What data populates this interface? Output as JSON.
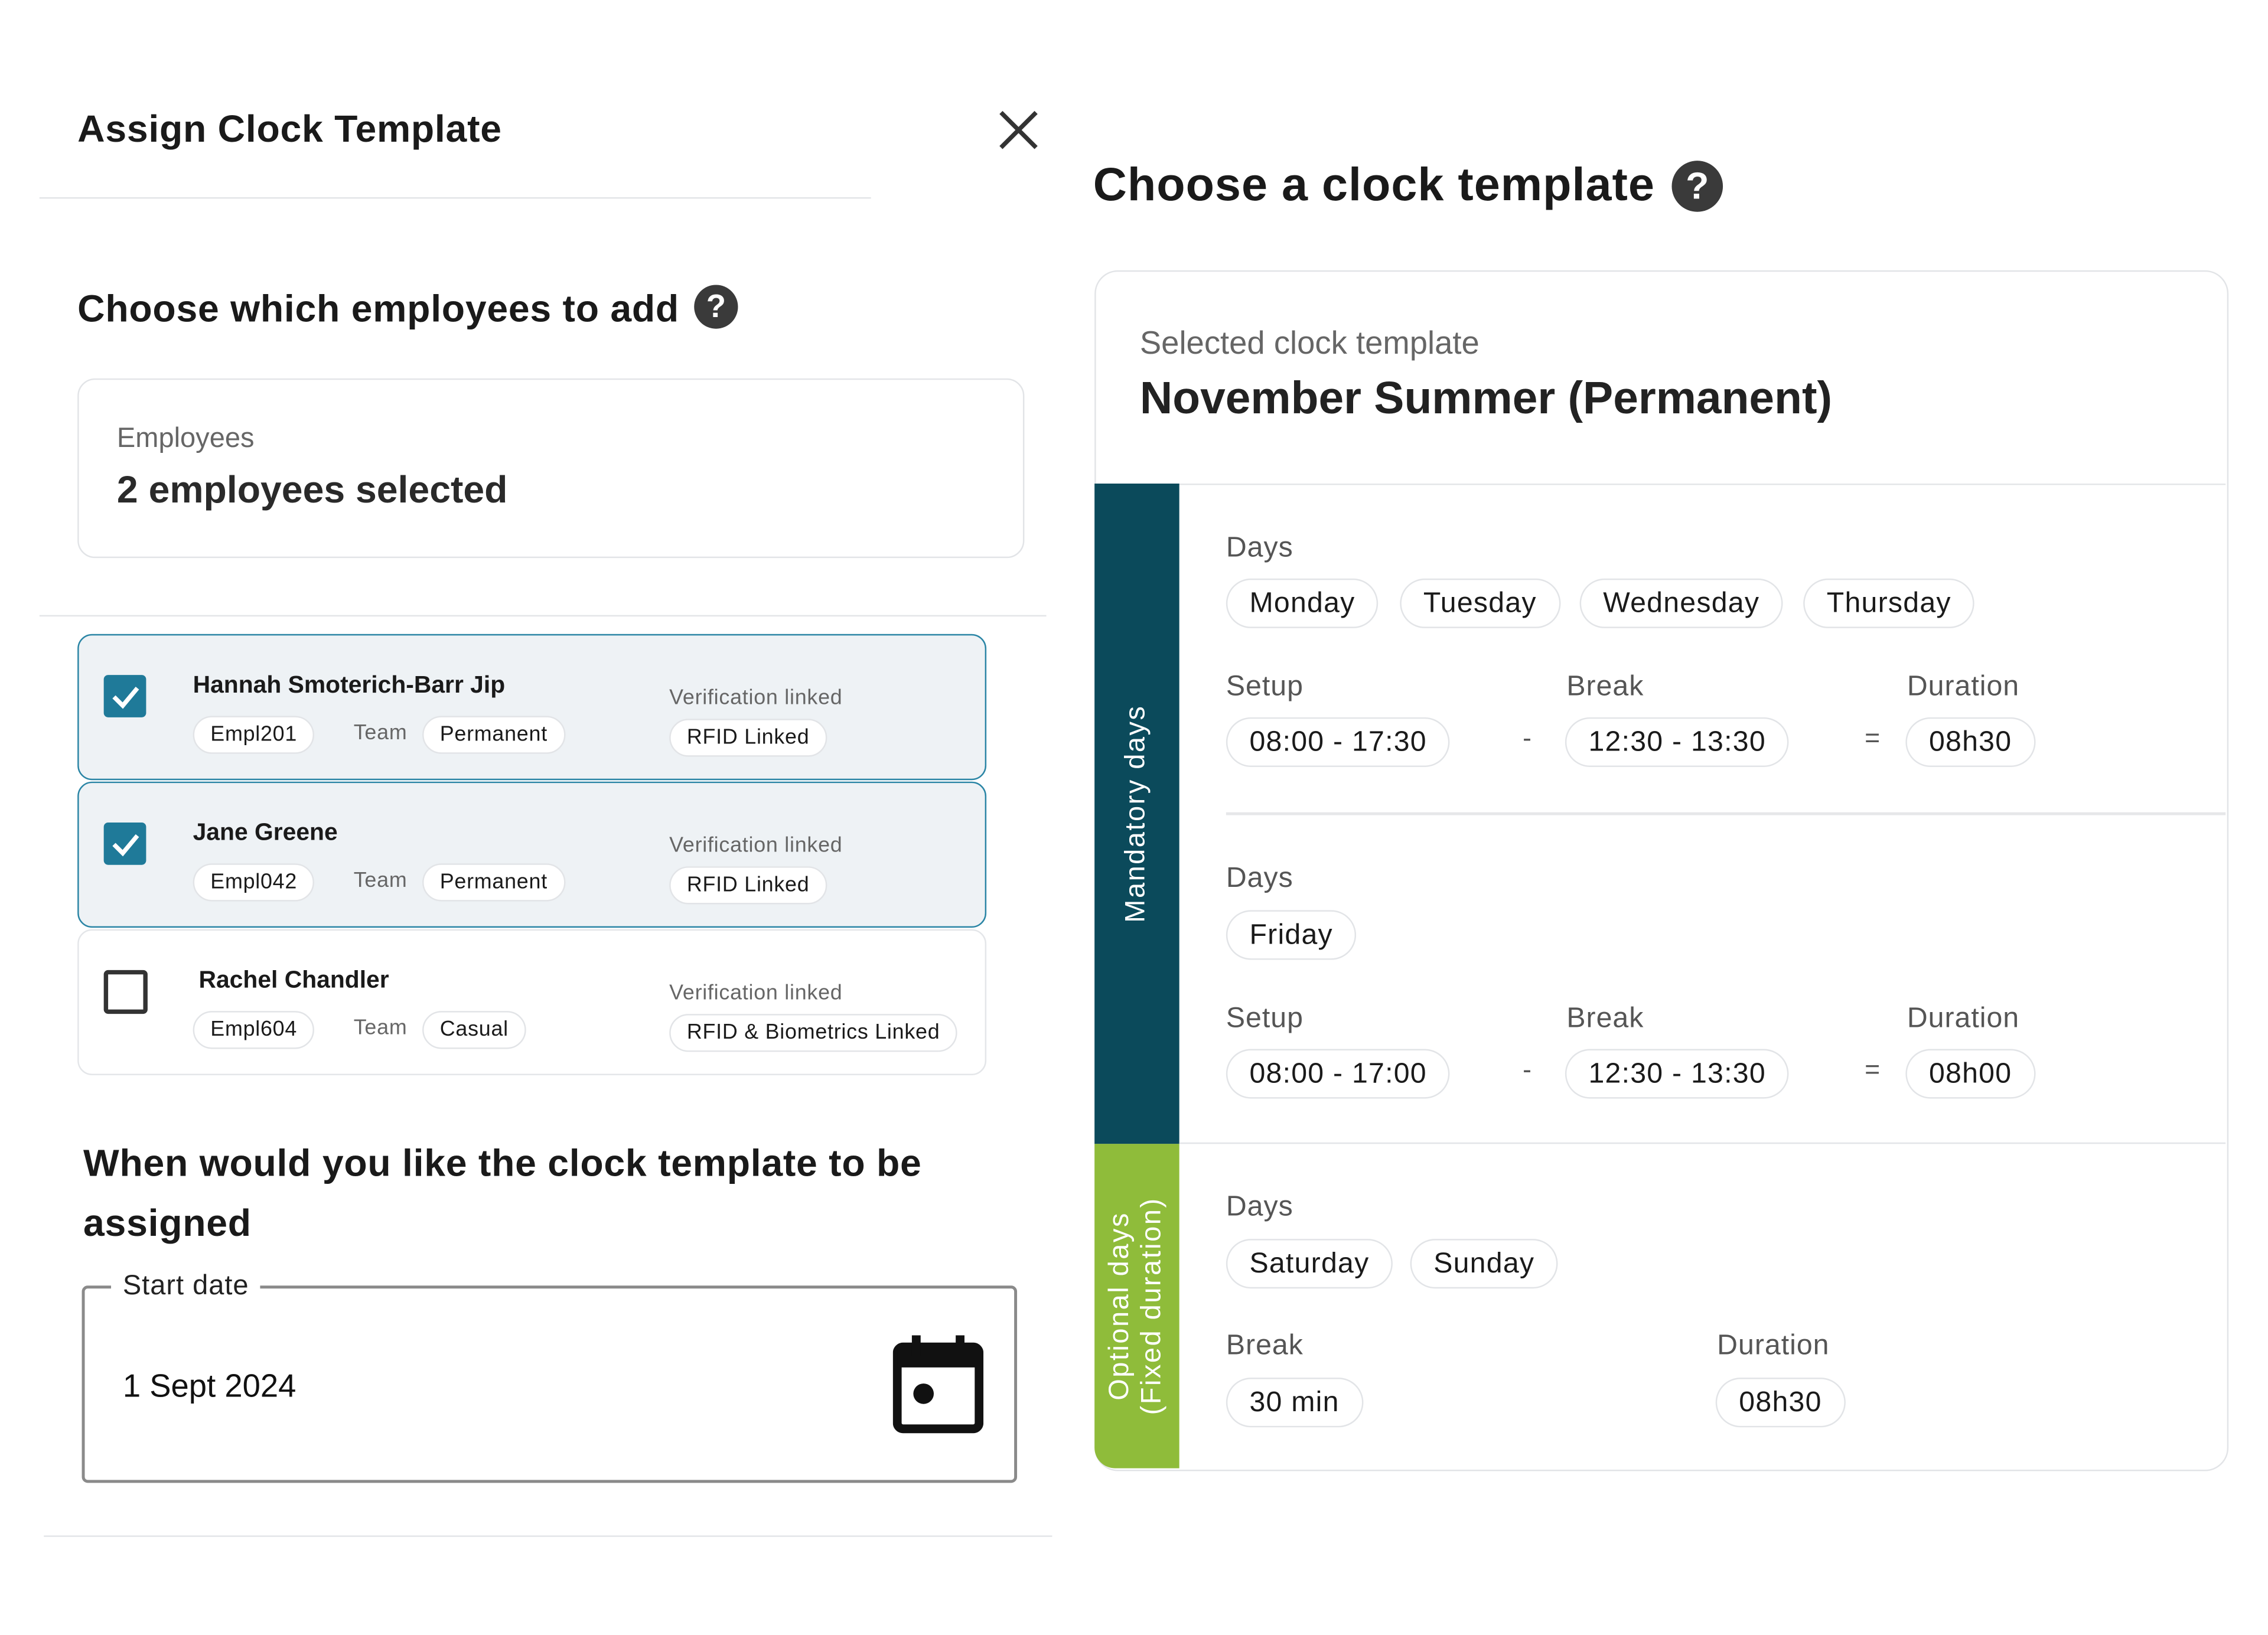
{
  "dialog": {
    "title": "Assign Clock Template",
    "close_icon": "close-icon",
    "employees_heading": "Choose which employees to add",
    "help_icon": "question-mark-circle-icon",
    "employees_field": {
      "label": "Employees",
      "value": "2 employees selected"
    },
    "team_label": "Team",
    "verification_label": "Verification linked",
    "employees": [
      {
        "name": "Hannah Smoterich-Barr Jip",
        "id": "Empl201",
        "team": "Permanent",
        "verification": "RFID Linked",
        "checked": true
      },
      {
        "name": "Jane Greene",
        "id": "Empl042",
        "team": "Permanent",
        "verification": "RFID Linked",
        "checked": true
      },
      {
        "name": "Rachel Chandler",
        "id": "Empl604",
        "team": "Casual",
        "verification": "RFID & Biometrics Linked",
        "checked": false
      }
    ],
    "assign_heading_line1": "When would you like the clock template to be",
    "assign_heading_line2": "assigned",
    "start_date": {
      "label": "Start date",
      "value": "1 Sept 2024",
      "icon": "calendar-icon"
    }
  },
  "template": {
    "heading": "Choose a clock template",
    "selected_label": "Selected clock template",
    "selected_name": "November Summer (Permanent)",
    "mandatory_label": "Mandatory days",
    "optional_label_line1": "Optional days",
    "optional_label_line2": "(Fixed duration)",
    "labels": {
      "days": "Days",
      "setup": "Setup",
      "break": "Break",
      "duration": "Duration",
      "minus": "-",
      "equals": "="
    },
    "mandatory_groups": [
      {
        "days": [
          "Monday",
          "Tuesday",
          "Wednesday",
          "Thursday"
        ],
        "setup": "08:00 - 17:30",
        "break": "12:30 - 13:30",
        "duration": "08h30"
      },
      {
        "days": [
          "Friday"
        ],
        "setup": "08:00 - 17:00",
        "break": "12:30 - 13:30",
        "duration": "08h00"
      }
    ],
    "optional_group": {
      "days": [
        "Saturday",
        "Sunday"
      ],
      "break": "30 min",
      "duration": "08h30"
    }
  },
  "colors": {
    "mandatory": "#0b4a5b",
    "optional": "#8fbc3a",
    "checkbox": "#1f7a99",
    "selected_card_bg": "#eef2f5"
  }
}
